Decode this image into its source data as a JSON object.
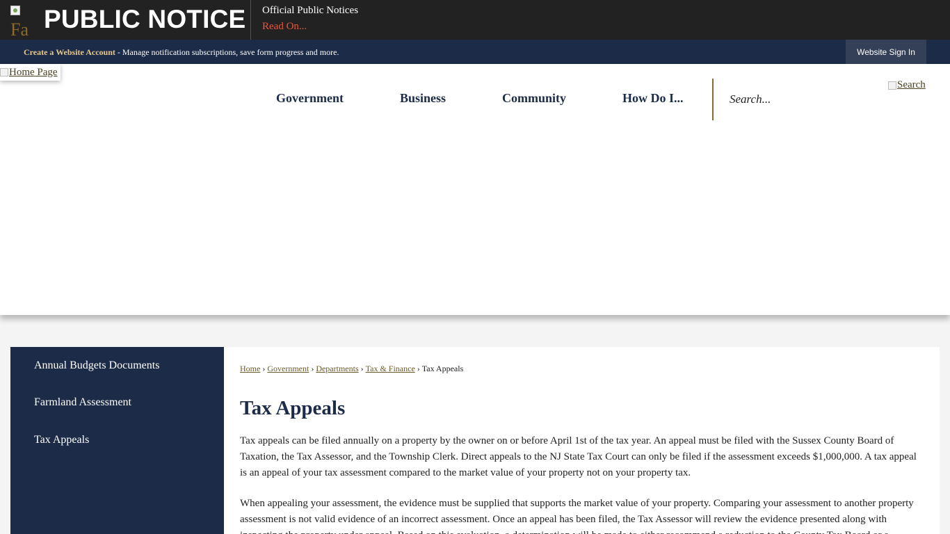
{
  "notice": {
    "icon_alt": "Fa",
    "title": "PUBLIC NOTICE",
    "heading": "Official Public Notices",
    "link": "Read On..."
  },
  "account": {
    "create_link": "Create a Website Account",
    "description": " - Manage notification subscriptions, save form progress and more.",
    "signin_label": "Website Sign In"
  },
  "header": {
    "home_link": "Home Page",
    "nav": [
      "Government",
      "Business",
      "Community",
      "How Do I..."
    ],
    "search_placeholder": "Search...",
    "search_button": "Search"
  },
  "sidebar": {
    "items": [
      "Annual Budgets Documents",
      "Farmland Assessment",
      "Tax Appeals"
    ]
  },
  "breadcrumb": {
    "links": [
      "Home",
      "Government",
      "Departments",
      "Tax & Finance"
    ],
    "current": "Tax Appeals",
    "separator": "›"
  },
  "main": {
    "title": "Tax Appeals",
    "paragraph1": "Tax appeals can be filed annually on a property by the owner on or before April 1st of the tax year. An appeal must be filed with the Sussex County Board of Taxation, the Tax Assessor, and the Township Clerk. Direct appeals to the NJ State Tax Court can only be filed if the assessment exceeds $1,000,000. A tax appeal is an appeal of your tax assessment compared to the market value of your property not on your property tax.",
    "paragraph2": "When appealing your assessment, the evidence must be supplied that supports the market value of your property. Comparing your assessment to another property assessment is not valid evidence of an incorrect assessment. Once an appeal has been filed, the Tax Assessor will review the evidence presented along with inspecting the property under appeal. Based on this evaluation, a determination will be made to either recommend a reduction to the County Tax Board or a"
  }
}
